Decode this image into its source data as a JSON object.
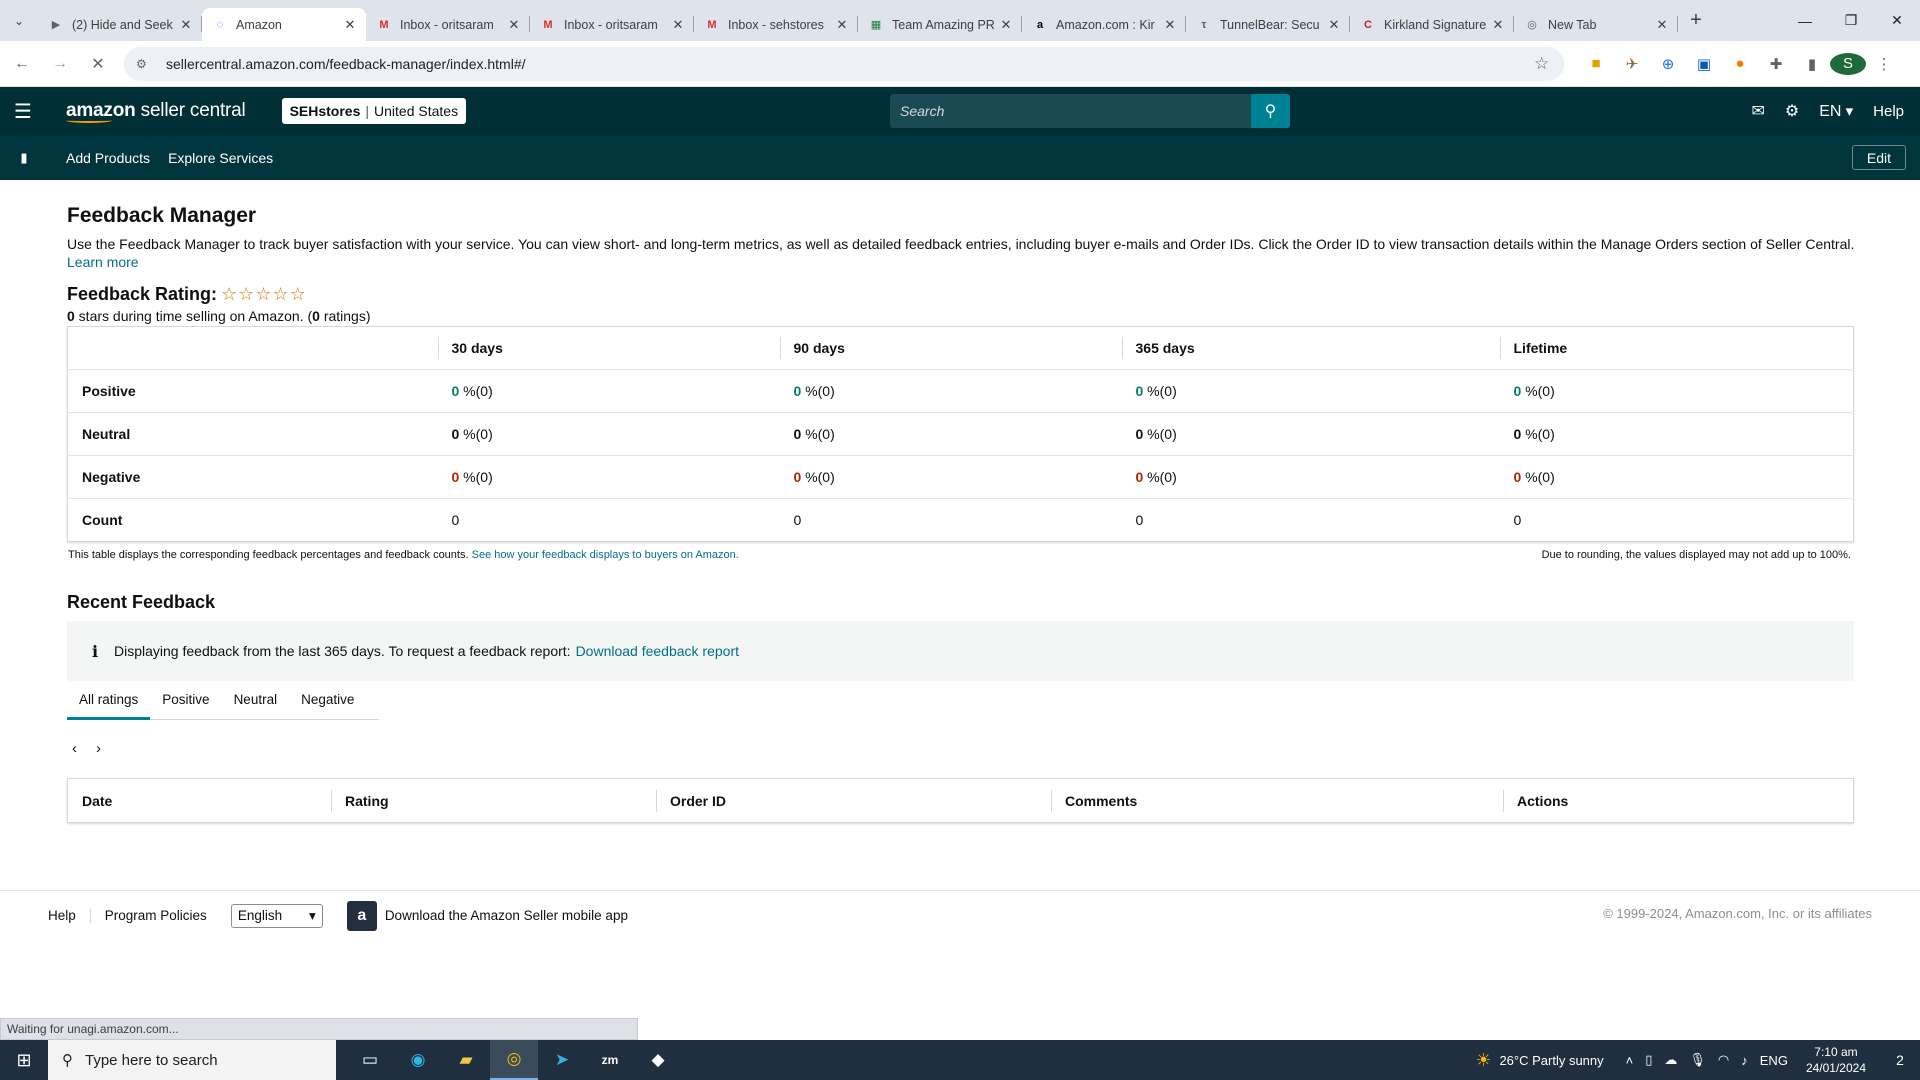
{
  "browser": {
    "tabs": [
      {
        "title": "(2) Hide and Seek",
        "icon": "video-icon"
      },
      {
        "title": "Amazon",
        "icon": "loading-icon",
        "active": true
      },
      {
        "title": "Inbox - oritsaram",
        "icon": "gmail-icon"
      },
      {
        "title": "Inbox - oritsaram",
        "icon": "gmail-icon"
      },
      {
        "title": "Inbox - sehstores",
        "icon": "gmail-icon"
      },
      {
        "title": "Team Amazing PR",
        "icon": "sheets-icon"
      },
      {
        "title": "Amazon.com : Kir",
        "icon": "amazon-icon"
      },
      {
        "title": "TunnelBear: Secu",
        "icon": "tunnelbear-icon"
      },
      {
        "title": "Kirkland Signature",
        "icon": "costco-icon"
      },
      {
        "title": "New Tab",
        "icon": "chrome-icon"
      }
    ],
    "url": "sellercentral.amazon.com/feedback-manager/index.html#/",
    "profile_initial": "S",
    "status_text": "Waiting for unagi.amazon.com..."
  },
  "header": {
    "logo_main": "amazon",
    "logo_sub": "seller central",
    "store_name": "SEHstores",
    "store_region": "United States",
    "search_placeholder": "Search",
    "lang": "EN",
    "help": "Help"
  },
  "subnav": {
    "items": [
      "Add Products",
      "Explore Services"
    ],
    "edit": "Edit"
  },
  "page": {
    "title": "Feedback Manager",
    "intro": "Use the Feedback Manager to track buyer satisfaction with your service. You can view short- and long-term metrics, as well as detailed feedback entries, including buyer e-mails and Order IDs. Click the Order ID to view transaction details within the Manage Orders section of Seller Central.",
    "learn_more": "Learn more",
    "rating_label": "Feedback Rating:",
    "stars_value": 0,
    "stars_max": 5,
    "rating_sub_stars": "0",
    "rating_sub_text1": " stars during time selling on Amazon. (",
    "rating_sub_count": "0",
    "rating_sub_text2": " ratings)"
  },
  "feedback_table": {
    "columns": [
      "30 days",
      "90 days",
      "365 days",
      "Lifetime"
    ],
    "rows": [
      {
        "label": "Positive",
        "cells": [
          {
            "v": "0",
            "p": " %(0)"
          },
          {
            "v": "0",
            "p": " %(0)"
          },
          {
            "v": "0",
            "p": " %(0)"
          },
          {
            "v": "0",
            "p": " %(0)"
          }
        ]
      },
      {
        "label": "Neutral",
        "cells": [
          {
            "v": "0",
            "p": " %(0)"
          },
          {
            "v": "0",
            "p": " %(0)"
          },
          {
            "v": "0",
            "p": " %(0)"
          },
          {
            "v": "0",
            "p": " %(0)"
          }
        ]
      },
      {
        "label": "Negative",
        "cells": [
          {
            "v": "0",
            "p": " %(0)"
          },
          {
            "v": "0",
            "p": " %(0)"
          },
          {
            "v": "0",
            "p": " %(0)"
          },
          {
            "v": "0",
            "p": " %(0)"
          }
        ]
      },
      {
        "label": "Count",
        "cells": [
          {
            "v": "0",
            "p": ""
          },
          {
            "v": "0",
            "p": ""
          },
          {
            "v": "0",
            "p": ""
          },
          {
            "v": "0",
            "p": ""
          }
        ]
      }
    ],
    "note": "This table displays the corresponding feedback percentages and feedback counts.",
    "note_link": "See how your feedback displays to buyers on Amazon.",
    "note_right": "Due to rounding, the values displayed may not add up to 100%."
  },
  "recent": {
    "title": "Recent Feedback",
    "info": "Displaying feedback from the last 365 days. To request a feedback report:",
    "info_link": "Download feedback report",
    "tabs": [
      "All ratings",
      "Positive",
      "Neutral",
      "Negative"
    ],
    "columns": [
      "Date",
      "Rating",
      "Order ID",
      "Comments",
      "Actions"
    ]
  },
  "footer": {
    "help": "Help",
    "policies": "Program Policies",
    "language": "English",
    "app_text": "Download the Amazon Seller mobile app",
    "copyright": "© 1999-2024, Amazon.com, Inc. or its affiliates"
  },
  "taskbar": {
    "search_placeholder": "Type here to search",
    "weather": "26°C  Partly sunny",
    "lang": "ENG",
    "time": "7:10 am",
    "date": "24/01/2024",
    "notifications": "2"
  },
  "colors": {
    "header_bg": "#002f36",
    "subnav_bg": "#00353d",
    "accent": "#008296",
    "positive": "#067d62",
    "negative": "#b12704",
    "link": "#007185"
  }
}
